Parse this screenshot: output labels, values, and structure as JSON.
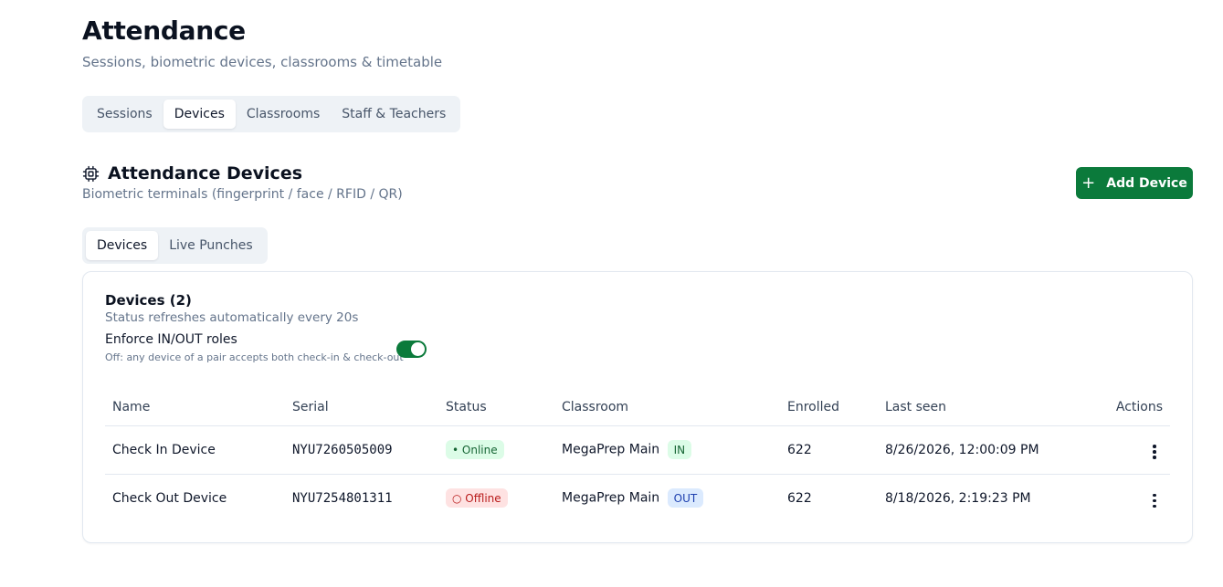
{
  "page": {
    "title": "Attendance",
    "subtitle": "Sessions, biometric devices, classrooms & timetable"
  },
  "main_tabs": [
    {
      "label": "Sessions",
      "active": false
    },
    {
      "label": "Devices",
      "active": true
    },
    {
      "label": "Classrooms",
      "active": false
    },
    {
      "label": "Staff & Teachers",
      "active": false
    }
  ],
  "section": {
    "icon": "chip-icon",
    "title": "Attendance Devices",
    "description": "Biometric terminals (fingerprint / face / RFID / QR)",
    "add_button_label": "Add Device",
    "add_button_icon": "plus-icon"
  },
  "sub_tabs": [
    {
      "label": "Devices",
      "active": true
    },
    {
      "label": "Live Punches",
      "active": false
    }
  ],
  "card": {
    "title": "Devices (2)",
    "description": "Status refreshes automatically every 20s",
    "enforce_label": "Enforce IN/OUT roles",
    "enforce_help": "Off: any device of a pair accepts both check-in & check-out",
    "enforce_enabled": true
  },
  "table": {
    "headers": [
      "Name",
      "Serial",
      "Status",
      "Classroom",
      "Enrolled",
      "Last seen",
      "Actions"
    ],
    "rows": [
      {
        "name": "Check In Device",
        "serial": "NYU7260505009",
        "status": "• Online",
        "status_kind": "online",
        "classroom": "MegaPrep Main",
        "role": "IN",
        "enrolled": "622",
        "last_seen": "8/26/2026, 12:00:09 PM"
      },
      {
        "name": "Check Out Device",
        "serial": "NYU7254801311",
        "status": "○ Offline",
        "status_kind": "offline",
        "classroom": "MegaPrep Main",
        "role": "OUT",
        "enrolled": "622",
        "last_seen": "8/18/2026, 2:19:23 PM"
      }
    ]
  },
  "colors": {
    "primary": "#0b7a3b",
    "online_bg": "#dcfce7",
    "offline_bg": "#fee2e2",
    "role_out_bg": "#dbeafe"
  }
}
